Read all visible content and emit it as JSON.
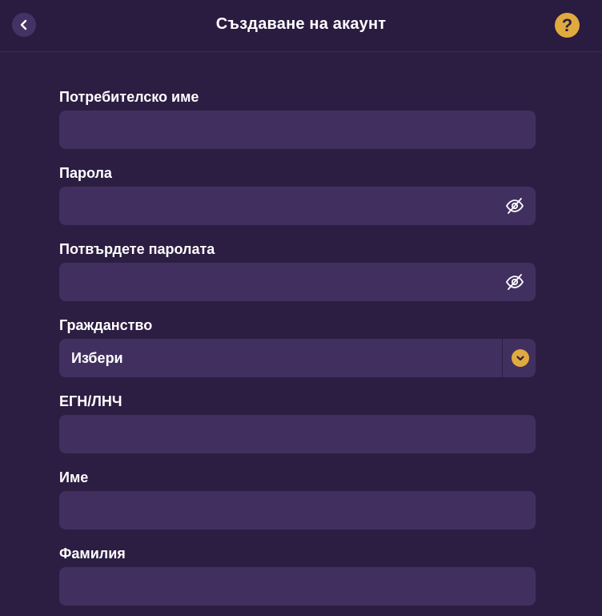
{
  "header": {
    "title": "Създаване на акаунт",
    "help_glyph": "?",
    "back_icon": "chevron-left-icon",
    "help_icon": "question-mark-icon",
    "accent_color": "#e0aa3e"
  },
  "form": {
    "username": {
      "label": "Потребителско име",
      "value": ""
    },
    "password": {
      "label": "Парола",
      "value": "",
      "icon": "eye-slash-icon"
    },
    "confirm_password": {
      "label": "Потвърдете паролата",
      "value": "",
      "icon": "eye-slash-icon"
    },
    "citizenship": {
      "label": "Гражданство",
      "selected": "Избери",
      "icon": "chevron-down-icon"
    },
    "egn": {
      "label": "ЕГН/ЛНЧ",
      "value": ""
    },
    "first_name": {
      "label": "Име",
      "value": ""
    },
    "last_name": {
      "label": "Фамилия",
      "value": ""
    }
  },
  "colors": {
    "background": "#2c1d42",
    "input_background": "#41305f",
    "accent": "#e0aa3e"
  }
}
